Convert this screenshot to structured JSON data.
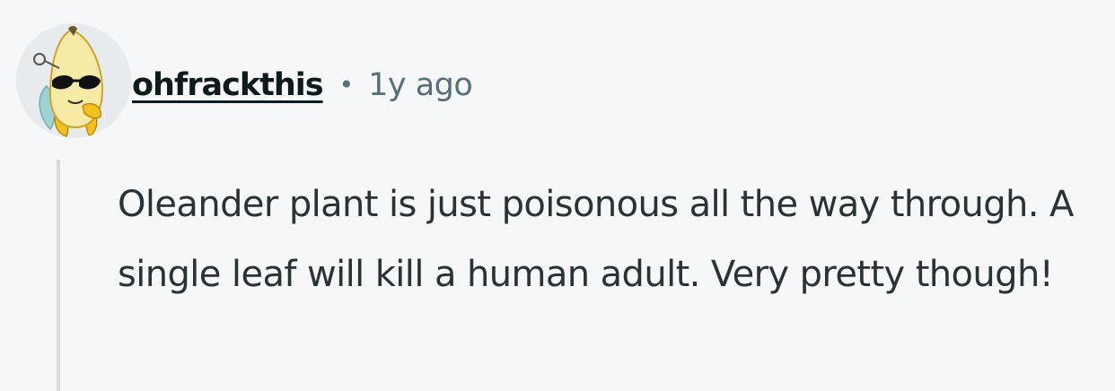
{
  "comment": {
    "avatar": "banana-sunglasses-avatar",
    "author": "ohfrackthis",
    "separator": "•",
    "timestamp": "1y ago",
    "body": "Oleander plant is just poisonous all the way through. A single leaf will kill a human adult. Very pretty though!"
  },
  "colors": {
    "background": "#f6f7f8",
    "username": "#0f1a1c",
    "meta": "#576f76",
    "body_text": "#2a3236",
    "thread_line": "#d4dadd"
  }
}
